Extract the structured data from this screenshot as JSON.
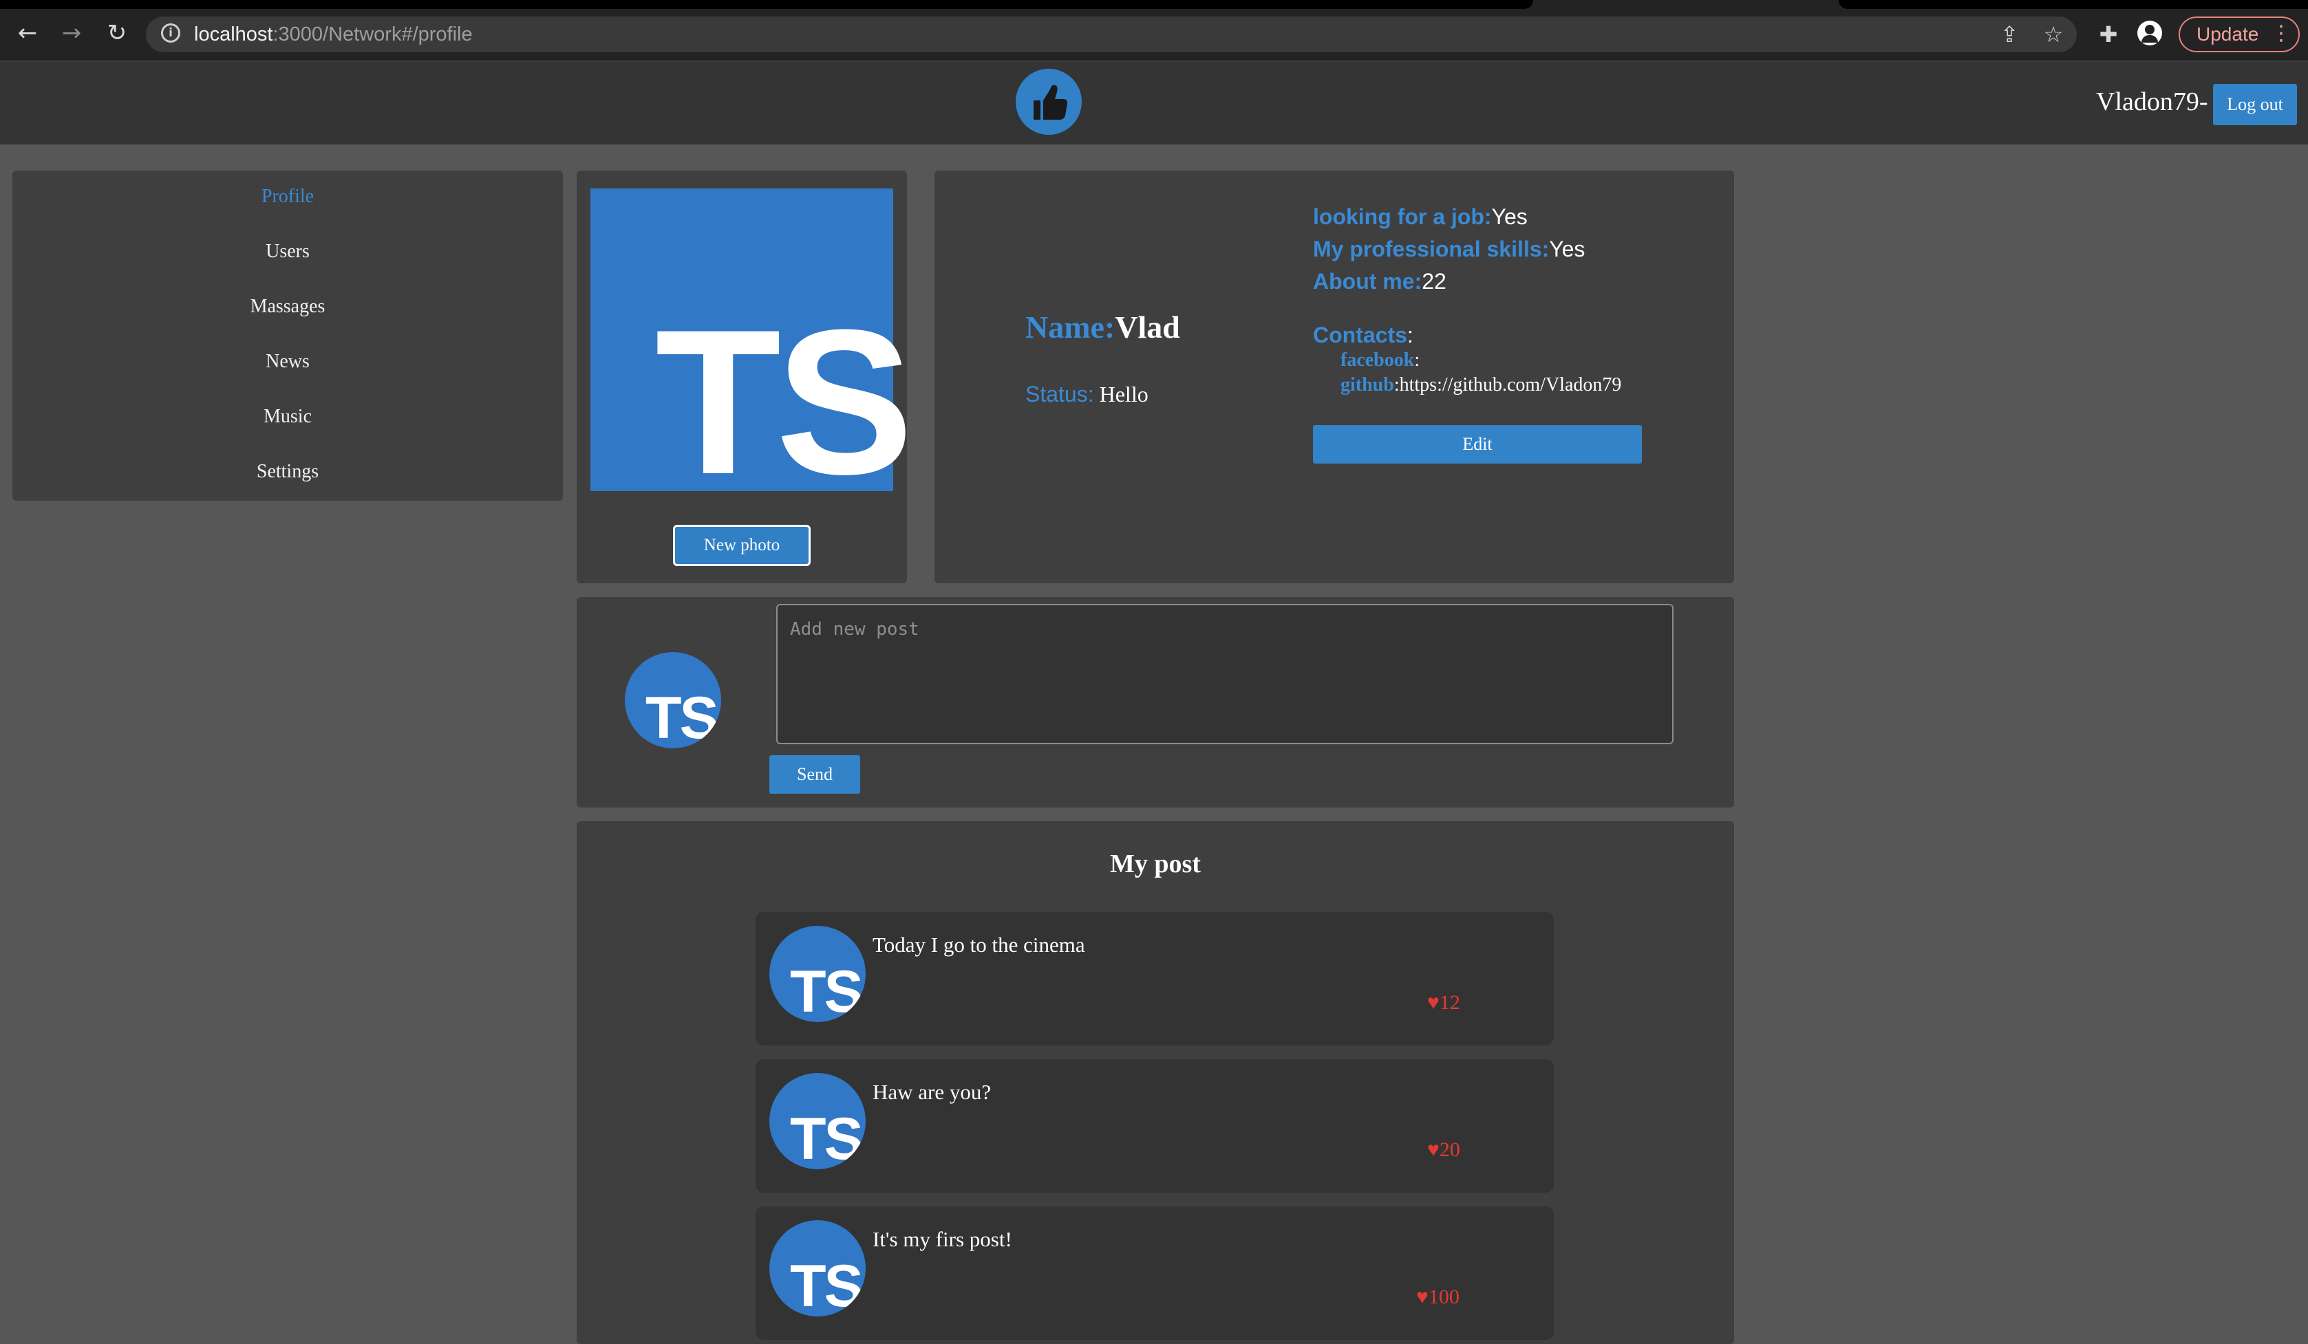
{
  "browser": {
    "url_host": "localhost",
    "url_path": ":3000/Network#/profile",
    "update_label": "Update"
  },
  "header": {
    "user_name": "Vladon79-",
    "logout_label": "Log out"
  },
  "sidebar": {
    "items": [
      {
        "label": "Profile",
        "active": true
      },
      {
        "label": "Users",
        "active": false
      },
      {
        "label": "Massages",
        "active": false
      },
      {
        "label": "News",
        "active": false
      },
      {
        "label": "Music",
        "active": false
      },
      {
        "label": "Settings",
        "active": false
      }
    ]
  },
  "profile": {
    "avatar_text": "TS",
    "new_photo_label": "New photo",
    "name_label": "Name:",
    "name_value": "Vlad",
    "status_label": "Status:",
    "status_value": "Hello",
    "looking_job_label": "looking for a job:",
    "looking_job_value": "Yes",
    "skills_label": "My professional skills:",
    "skills_value": "Yes",
    "about_label": "About me:",
    "about_value": "22",
    "contacts_label": "Contacts",
    "contacts": [
      {
        "name": "facebook",
        "value": ""
      },
      {
        "name": "github",
        "value": "https://github.com/Vladon79"
      }
    ],
    "edit_label": "Edit"
  },
  "new_post": {
    "placeholder": "Add new post",
    "send_label": "Send"
  },
  "posts": {
    "title": "My post",
    "items": [
      {
        "text": "Today I go to the cinema",
        "likes": "♥12"
      },
      {
        "text": "Haw are you?",
        "likes": "♥20"
      },
      {
        "text": "It's my firs post!",
        "likes": "♥100"
      }
    ]
  },
  "colors": {
    "accent": "#3283c8",
    "background": "#575757",
    "panel": "#3f3f3f",
    "like": "#e53935"
  }
}
